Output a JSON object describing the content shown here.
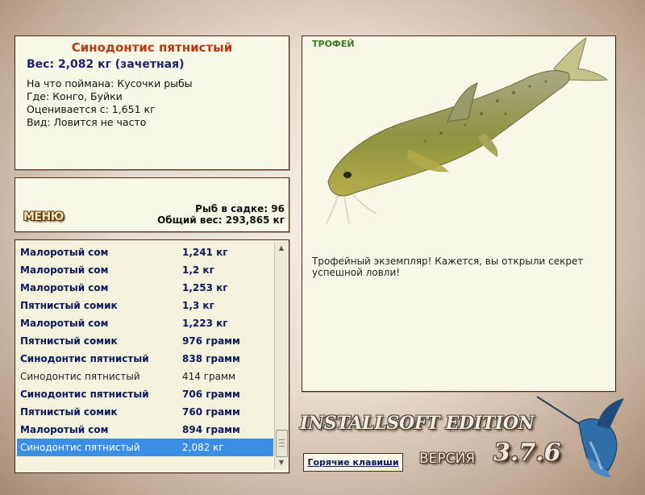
{
  "catch_info": {
    "fish_name": "Синодонтис пятнистый",
    "weight_line": "Вес: 2,082 кг (зачетная)",
    "bait_line": "На что поймана: Кусочки рыбы",
    "location_line": "Где: Конго, Буйки",
    "min_weight_line": "Оценивается с: 1,651 кг",
    "rarity_line": "Вид: Ловится не часто"
  },
  "status": {
    "menu_label": "МЕНЮ",
    "fish_in_keepnet": "Рыб в садке: 96",
    "total_weight": "Общий вес: 293,865 кг"
  },
  "catch_list": [
    {
      "name": "Малоротый сом",
      "weight": "1,241 кг"
    },
    {
      "name": "Малоротый сом",
      "weight": "1,2 кг"
    },
    {
      "name": "Малоротый сом",
      "weight": "1,253 кг"
    },
    {
      "name": "Пятнистый сомик",
      "weight": "1,3 кг"
    },
    {
      "name": "Малоротый сом",
      "weight": "1,223 кг"
    },
    {
      "name": "Пятнистый сомик",
      "weight": "976 грамм"
    },
    {
      "name": "Синодонтис пятнистый",
      "weight": "838 грамм"
    },
    {
      "name": "Синодонтис пятнистый",
      "weight": "414 грамм"
    },
    {
      "name": "Синодонтис пятнистый",
      "weight": "706 грамм"
    },
    {
      "name": "Пятнистый сомик",
      "weight": "760 грамм"
    },
    {
      "name": "Малоротый сом",
      "weight": "894 грамм"
    },
    {
      "name": "Синодонтис пятнистый",
      "weight": "2,082 кг"
    }
  ],
  "trophy": {
    "tag": "ТРОФЕЙ",
    "message": "Трофейный экземпляр! Кажется, вы открыли секрет успешной ловли!"
  },
  "footer": {
    "brand": "INSTALLSOFT EDITION",
    "version_label": "ВЕРСИЯ",
    "version_number": "3.7.6",
    "hotkeys_label": "Горячие клавиши"
  },
  "colors": {
    "panel_bg": "#f8f7e8",
    "panel_border": "#4a2a18",
    "title_red": "#b83a10",
    "list_blue": "#0a1a5c",
    "selection": "#3a8ee6",
    "trophy_green": "#3a7a22"
  }
}
